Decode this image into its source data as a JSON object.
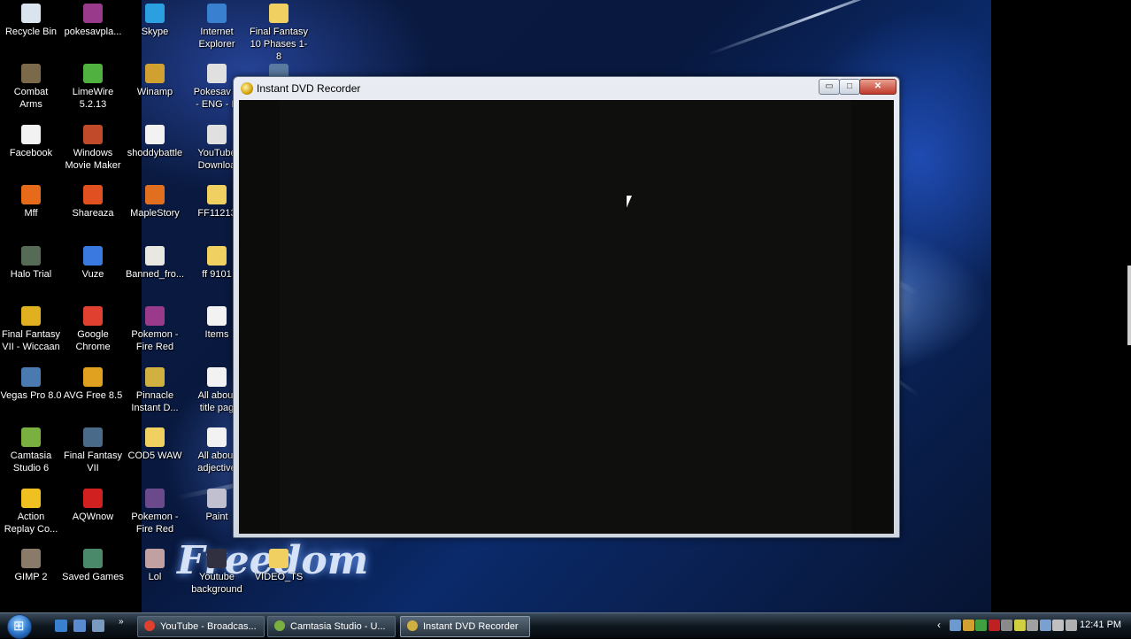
{
  "desktop": {
    "icons": [
      {
        "label": "Recycle Bin",
        "icon": "recycle-bin-icon",
        "color": "#d9e4ee"
      },
      {
        "label": "Combat\nArms",
        "icon": "game-icon",
        "color": "#7a6a4a"
      },
      {
        "label": "Facebook",
        "icon": "document-icon",
        "color": "#f2f2f2"
      },
      {
        "label": "Mff",
        "icon": "firefox-icon",
        "color": "#e66a1a"
      },
      {
        "label": "Halo Trial",
        "icon": "halo-icon",
        "color": "#556b55"
      },
      {
        "label": "Final Fantasy\nVII - Wiccaan",
        "icon": "game-icon",
        "color": "#e0b020"
      },
      {
        "label": "Vegas Pro 8.0",
        "icon": "vegas-icon",
        "color": "#4a7ab0"
      },
      {
        "label": "Camtasia\nStudio 6",
        "icon": "camtasia-icon",
        "color": "#7ab040"
      },
      {
        "label": "Action\nReplay Co...",
        "icon": "action-replay-icon",
        "color": "#f0c020"
      },
      {
        "label": "GIMP 2",
        "icon": "gimp-icon",
        "color": "#8a7a6a"
      },
      {
        "label": "pokesavpla...",
        "icon": "archive-icon",
        "color": "#9a3a8a"
      },
      {
        "label": "LimeWire\n5.2.13",
        "icon": "limewire-icon",
        "color": "#50b040"
      },
      {
        "label": "Windows\nMovie Maker",
        "icon": "movie-maker-icon",
        "color": "#c04a2a"
      },
      {
        "label": "Shareaza",
        "icon": "shareaza-icon",
        "color": "#e05020"
      },
      {
        "label": "Vuze",
        "icon": "vuze-icon",
        "color": "#3a7ae0"
      },
      {
        "label": "Google\nChrome",
        "icon": "chrome-icon",
        "color": "#e04030"
      },
      {
        "label": "AVG Free 8.5",
        "icon": "avg-icon",
        "color": "#e0a020"
      },
      {
        "label": "Final Fantasy\nVII",
        "icon": "game-icon",
        "color": "#4a6a8a"
      },
      {
        "label": "AQWnow",
        "icon": "flash-icon",
        "color": "#d02020"
      },
      {
        "label": "Saved Games",
        "icon": "saved-games-icon",
        "color": "#4a8a6a"
      },
      {
        "label": "Skype",
        "icon": "skype-icon",
        "color": "#2aa0e0"
      },
      {
        "label": "Winamp",
        "icon": "winamp-icon",
        "color": "#d0a030"
      },
      {
        "label": "shoddybattle",
        "icon": "document-icon",
        "color": "#f2f2f2"
      },
      {
        "label": "MapleStory",
        "icon": "maplestory-icon",
        "color": "#e07020"
      },
      {
        "label": "Banned_fro...",
        "icon": "document-icon",
        "color": "#e8e8e0"
      },
      {
        "label": "Pokemon -\nFire Red",
        "icon": "archive-icon",
        "color": "#9a3a8a"
      },
      {
        "label": "Pinnacle\nInstant D...",
        "icon": "pinnacle-icon",
        "color": "#d0b040"
      },
      {
        "label": "COD5 WAW",
        "icon": "folder-icon",
        "color": "#f0d060"
      },
      {
        "label": "Pokemon -\nFire Red",
        "icon": "game-icon",
        "color": "#6a4a8a"
      },
      {
        "label": "Lol",
        "icon": "image-icon",
        "color": "#c0a0a0"
      },
      {
        "label": "Internet\nExplorer",
        "icon": "ie-icon",
        "color": "#3a80d0"
      },
      {
        "label": "Pokesav P\n- ENG - P",
        "icon": "pokesav-icon",
        "color": "#e0e0e0"
      },
      {
        "label": "YouTube\nDownloa",
        "icon": "youtube-icon",
        "color": "#e0e0e0"
      },
      {
        "label": "FF11213",
        "icon": "folder-icon",
        "color": "#f0d060"
      },
      {
        "label": "ff 9101",
        "icon": "folder-icon",
        "color": "#f0d060"
      },
      {
        "label": "Items",
        "icon": "document-icon",
        "color": "#f2f2f2"
      },
      {
        "label": "All about\ntitle pag",
        "icon": "document-icon",
        "color": "#f2f2f2"
      },
      {
        "label": "All about\nadjective",
        "icon": "document-icon",
        "color": "#f2f2f2"
      },
      {
        "label": "Paint",
        "icon": "paint-icon",
        "color": "#c0c0d0"
      },
      {
        "label": "Youtube\nbackground",
        "icon": "image-icon",
        "color": "#303040"
      },
      {
        "label": "Final Fantasy\n10 Phases 1-8",
        "icon": "folder-icon",
        "color": "#f0d060"
      },
      {
        "label": "",
        "icon": "computer-icon",
        "color": "#5a7aa0"
      },
      {
        "label": "VIDEO_TS",
        "icon": "folder-icon",
        "color": "#f0d060"
      }
    ]
  },
  "wallpaper": {
    "text": "Freedom"
  },
  "window": {
    "title": "Instant DVD Recorder",
    "minimize": "▭",
    "maximize": "□",
    "close": "✕"
  },
  "taskbar": {
    "quick_launch": [
      {
        "icon": "ie-icon",
        "color": "#3a80d0"
      },
      {
        "icon": "show-desktop-icon",
        "color": "#5a8ad0"
      },
      {
        "icon": "switch-windows-icon",
        "color": "#7a9ac0"
      }
    ],
    "quick_launch_expand": "»",
    "tasks": [
      {
        "label": "YouTube - Broadcas...",
        "icon": "chrome-icon",
        "color": "#e04030",
        "active": false
      },
      {
        "label": "Camtasia Studio - U...",
        "icon": "camtasia-icon",
        "color": "#7ab040",
        "active": false
      },
      {
        "label": "Instant DVD Recorder",
        "icon": "pinnacle-icon",
        "color": "#d0b040",
        "active": true
      }
    ],
    "tray_expand": "‹",
    "tray_icons": [
      {
        "icon": "tray-icon-1",
        "color": "#6a9ad0"
      },
      {
        "icon": "tray-icon-2",
        "color": "#d0a030"
      },
      {
        "icon": "tray-icon-3",
        "color": "#40a040"
      },
      {
        "icon": "ati-icon",
        "color": "#c02020"
      },
      {
        "icon": "tray-icon-5",
        "color": "#8a8a8a"
      },
      {
        "icon": "tray-icon-6",
        "color": "#d0d040"
      },
      {
        "icon": "tray-icon-7",
        "color": "#a0a0a0"
      },
      {
        "icon": "network-icon",
        "color": "#7aa0d0"
      },
      {
        "icon": "volume-icon",
        "color": "#c0c0c0"
      },
      {
        "icon": "tray-icon-10",
        "color": "#b0b0b0"
      }
    ],
    "clock": "12:41 PM"
  }
}
